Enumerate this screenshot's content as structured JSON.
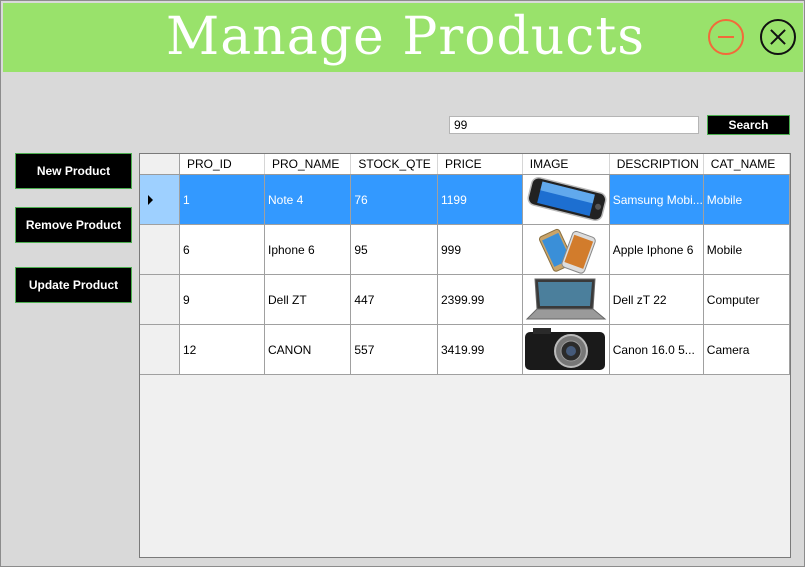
{
  "window": {
    "title": "Manage Products",
    "accent": "#99e26b"
  },
  "search": {
    "value": "99",
    "button_label": "Search"
  },
  "actions": {
    "new_label": "New Product",
    "remove_label": "Remove Product",
    "update_label": "Update Product"
  },
  "table": {
    "columns": [
      "PRO_ID",
      "PRO_NAME",
      "STOCK_QTE",
      "PRICE",
      "IMAGE",
      "DESCRIPTION",
      "CAT_NAME"
    ],
    "rows": [
      {
        "id": "1",
        "name": "Note 4",
        "stock": "76",
        "price": "1199",
        "image": "smartphone-image",
        "description": "Samsung Mobi...",
        "category": "Mobile",
        "selected": true
      },
      {
        "id": "6",
        "name": "Iphone 6",
        "stock": "95",
        "price": "999",
        "image": "smartphones-image",
        "description": "Apple Iphone 6",
        "category": "Mobile",
        "selected": false
      },
      {
        "id": "9",
        "name": "Dell ZT",
        "stock": "447",
        "price": "2399.99",
        "image": "laptop-image",
        "description": "Dell zT 22",
        "category": "Computer",
        "selected": false
      },
      {
        "id": "12",
        "name": "CANON",
        "stock": "557",
        "price": "3419.99",
        "image": "camera-image",
        "description": "Canon 16.0 5...",
        "category": "Camera",
        "selected": false
      }
    ]
  }
}
